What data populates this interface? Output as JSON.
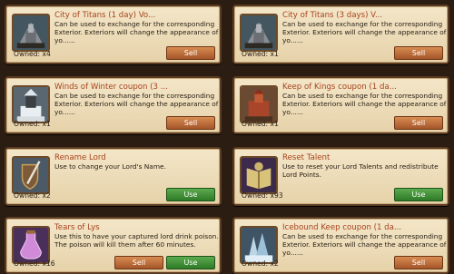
{
  "items": [
    {
      "title": "City of Titans (1 day) Vo...",
      "desc": "Can be used to exchange for the corresponding Exterior. Exteriors will change the appearance of yo......",
      "owned": "Owned: x4",
      "icon": "castle-icon",
      "buttons": [
        "Sell"
      ]
    },
    {
      "title": "City of Titans (3 days) V...",
      "desc": "Can be used to exchange for the corresponding Exterior. Exteriors will change the appearance of yo......",
      "owned": "Owned: x1",
      "icon": "castle-icon",
      "buttons": [
        "Sell"
      ]
    },
    {
      "title": "Winds of Winter coupon (3 ...",
      "desc": "Can be used to exchange for the corresponding Exterior. Exteriors will change the appearance of yo......",
      "owned": "Owned: x1",
      "icon": "snow-tower-icon",
      "buttons": [
        "Sell"
      ]
    },
    {
      "title": "Keep of Kings coupon (1 da...",
      "desc": "Can be used to exchange for the corresponding Exterior. Exteriors will change the appearance of yo......",
      "owned": "Owned: x1",
      "icon": "red-keep-icon",
      "buttons": [
        "Sell"
      ]
    },
    {
      "title": "Rename Lord",
      "desc": "Use to change your Lord's Name.",
      "owned": "Owned: x2",
      "icon": "shield-quill-icon",
      "buttons": [
        "Use"
      ]
    },
    {
      "title": "Reset Talent",
      "desc": "Use to reset your Lord Talents and redistribute Lord Points.",
      "owned": "Owned: x93",
      "icon": "book-icon",
      "buttons": [
        "Use"
      ]
    },
    {
      "title": "Tears of Lys",
      "desc": "Use this to have your captured lord drink poison. The poison will kill them after 60 minutes.",
      "owned": "Owned: x16",
      "icon": "poison-vial-icon",
      "buttons": [
        "Sell",
        "Use"
      ]
    },
    {
      "title": "Icebound Keep coupon (1 da...",
      "desc": "Can be used to exchange for the corresponding Exterior. Exteriors will change the appearance of yo......",
      "owned": "Owned: x2",
      "icon": "ice-keep-icon",
      "buttons": [
        "Sell"
      ]
    }
  ]
}
